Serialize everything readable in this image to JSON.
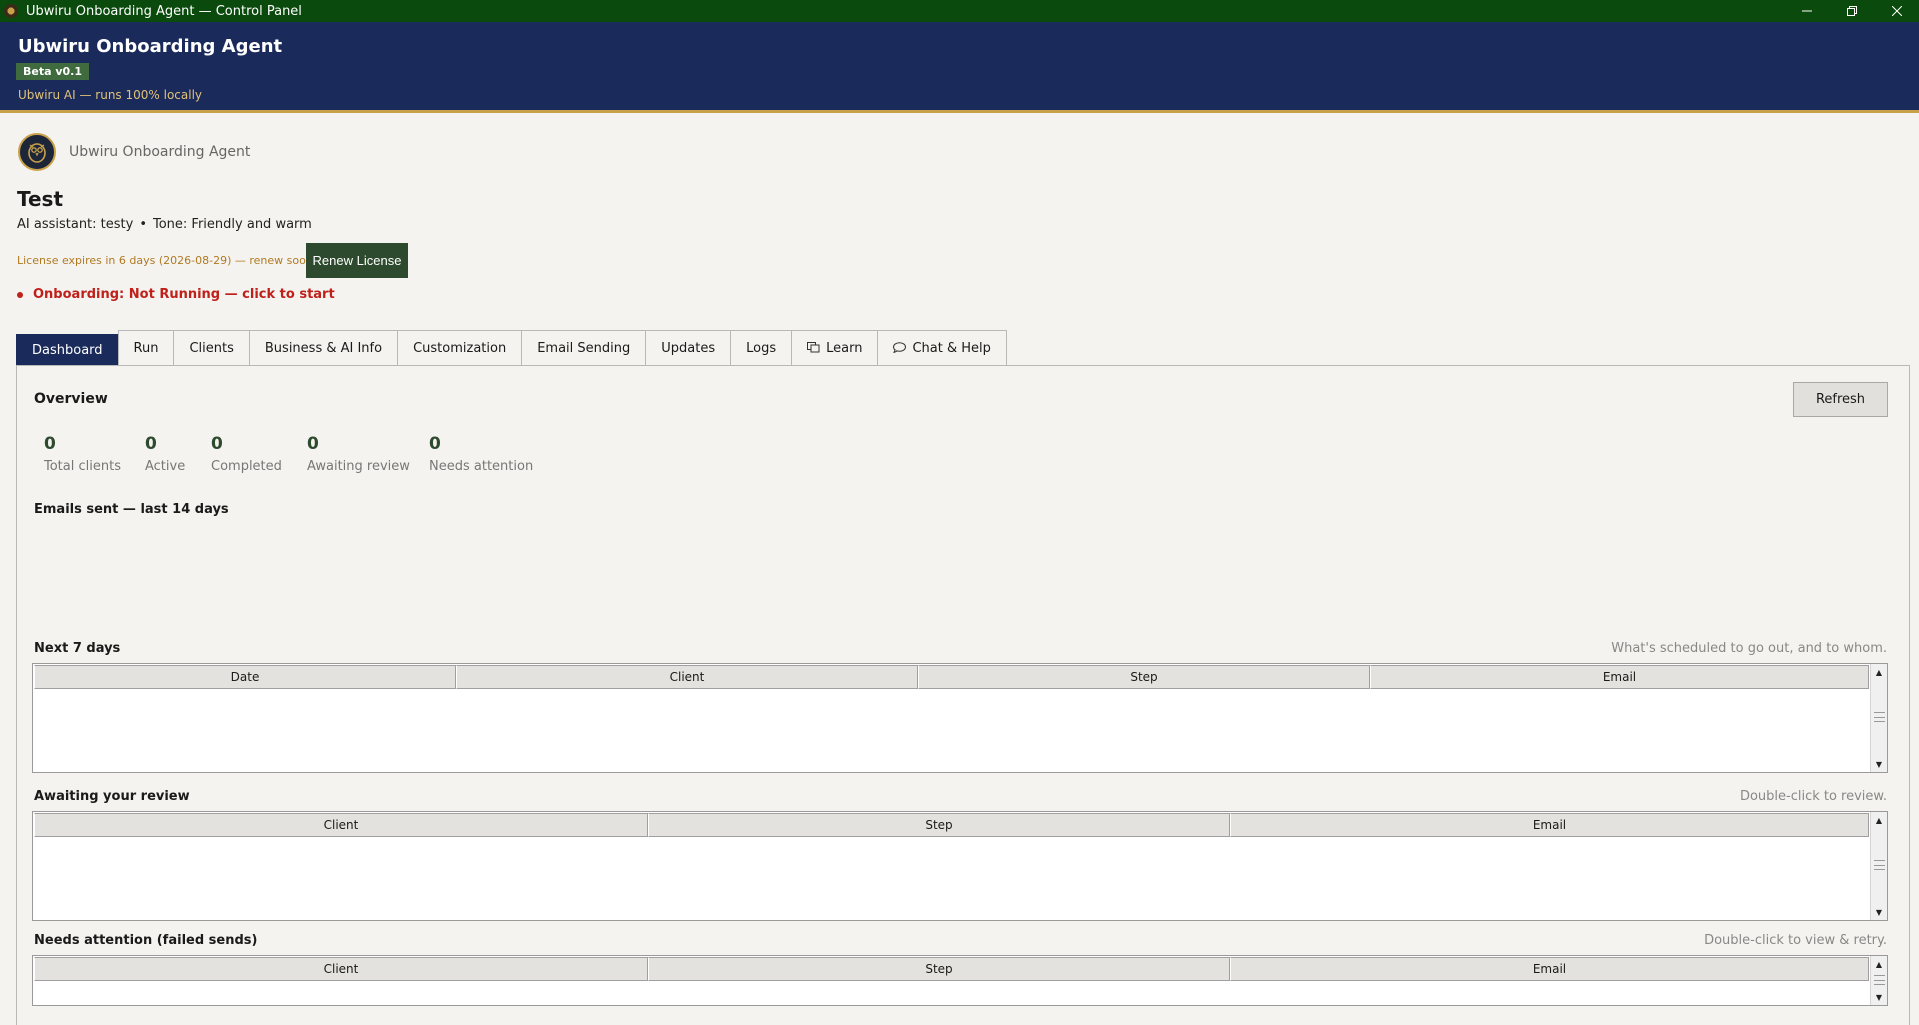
{
  "window": {
    "title": "Ubwiru Onboarding Agent — Control Panel",
    "controls": [
      "minimize",
      "restore",
      "close"
    ]
  },
  "header": {
    "title": "Ubwiru Onboarding Agent",
    "badge": "Beta v0.1",
    "subtitle": "Ubwiru AI — runs 100% locally"
  },
  "brand": {
    "name": "Ubwiru Onboarding Agent",
    "logo_icon": "owl-logo-icon"
  },
  "agent": {
    "name": "Test",
    "assistant": "AI assistant: testy",
    "separator": "•",
    "tone": "Tone: Friendly and warm"
  },
  "license": {
    "text": "License expires in 6 days (2026-08-29) — renew soon",
    "button": "Renew License"
  },
  "status": {
    "text": "Onboarding: Not Running — click to start",
    "color": "#c0201a"
  },
  "tabs": [
    {
      "label": "Dashboard",
      "active": true
    },
    {
      "label": "Run"
    },
    {
      "label": "Clients"
    },
    {
      "label": "Business & AI Info"
    },
    {
      "label": "Customization"
    },
    {
      "label": "Email Sending"
    },
    {
      "label": "Updates"
    },
    {
      "label": "Logs"
    },
    {
      "label": "Learn",
      "icon": "book-icon"
    },
    {
      "label": "Chat & Help",
      "icon": "chat-bubble-icon"
    }
  ],
  "dashboard": {
    "overview_title": "Overview",
    "refresh": "Refresh",
    "stats": [
      {
        "value": "0",
        "label": "Total clients"
      },
      {
        "value": "0",
        "label": "Active"
      },
      {
        "value": "0",
        "label": "Completed"
      },
      {
        "value": "0",
        "label": "Awaiting review"
      },
      {
        "value": "0",
        "label": "Needs attention"
      }
    ],
    "emails_title": "Emails sent — last 14 days",
    "next7": {
      "title": "Next 7 days",
      "hint": "What's scheduled to go out, and to whom.",
      "columns": [
        "Date",
        "Client",
        "Step",
        "Email"
      ],
      "rows": []
    },
    "awaiting": {
      "title": "Awaiting your review",
      "hint": "Double-click to review.",
      "columns": [
        "Client",
        "Step",
        "Email"
      ],
      "rows": []
    },
    "attention": {
      "title": "Needs attention (failed sends)",
      "hint": "Double-click to view & retry.",
      "columns": [
        "Client",
        "Step",
        "Email"
      ],
      "rows": []
    }
  },
  "colors": {
    "titlebar": "#0a4a0c",
    "header": "#1a2a5a",
    "accent_gold": "#c9a14a",
    "button_green": "#2e4a2e",
    "license_warning": "#b07a22"
  }
}
